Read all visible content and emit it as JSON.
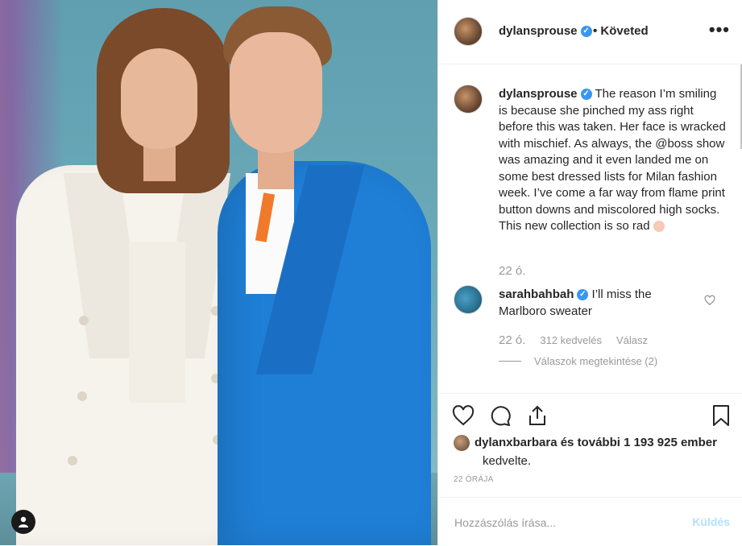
{
  "post": {
    "author": "dylansprouse",
    "follow_status": "Követed",
    "more": "•••",
    "caption_text": "The reason I’m smiling is because she pinched my ass right before this was taken. Her face is wracked with mischief. As always, the @boss show was amazing and it even landed me on some best dressed lists for Milan fashion week. I’ve come a far way from flame print button downs and miscolored high socks. This new collection is so rad",
    "caption_time": "22 ó."
  },
  "comment": {
    "author": "sarahbahbah",
    "text": "I’ll miss the Marlboro sweater",
    "time": "22 ó.",
    "likes": "312 kedvelés",
    "reply": "Válasz",
    "view_replies": "Válaszok megtekintése (2)"
  },
  "likes": {
    "line1_user": "dylanxbarbara",
    "line1_rest": " és további 1 193 925 ember",
    "line2": "kedvelte."
  },
  "timestamp": "22 ÓRÁJA",
  "comment_box": {
    "placeholder": "Hozzászólás írása...",
    "post_label": "Küldés"
  },
  "colors": {
    "verified": "#3897f0",
    "post_disabled": "#b2dffc",
    "suit": "#1f7fd6"
  },
  "icons": [
    "heart-icon",
    "comment-icon",
    "share-icon",
    "bookmark-icon",
    "verified-icon",
    "more-icon",
    "user-tag-icon"
  ]
}
